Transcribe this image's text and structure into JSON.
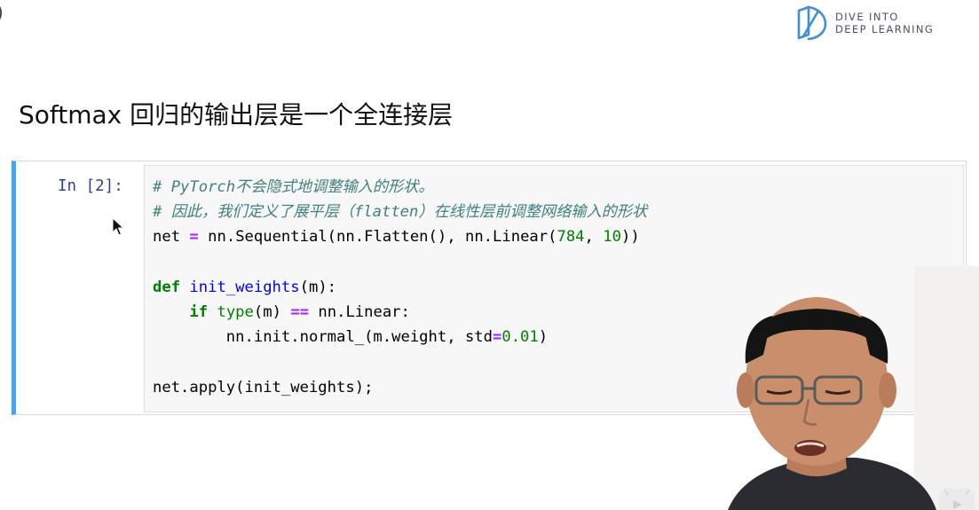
{
  "corner_glyph": ")",
  "logo": {
    "line1": "DIVE INTO",
    "line2": "DEEP LEARNING",
    "icon": "book-logo-icon",
    "color": "#3f8ed8"
  },
  "slide": {
    "title": "Softmax 回归的输出层是一个全连接层"
  },
  "cell": {
    "prompt": "In [2]:",
    "accent_color": "#42a5f5",
    "code_lines": [
      "# PyTorch不会隐式地调整输入的形状。",
      "# 因此，我们定义了展平层（flatten）在线性层前调整网络输入的形状",
      "net = nn.Sequential(nn.Flatten(), nn.Linear(784, 10))",
      "",
      "def init_weights(m):",
      "    if type(m) == nn.Linear:",
      "        nn.init.normal_(m.weight, std=0.01)",
      "",
      "net.apply(init_weights);"
    ]
  },
  "icons": {
    "cursor": "mouse-pointer-icon",
    "watermark": "video-watermark-icon"
  }
}
